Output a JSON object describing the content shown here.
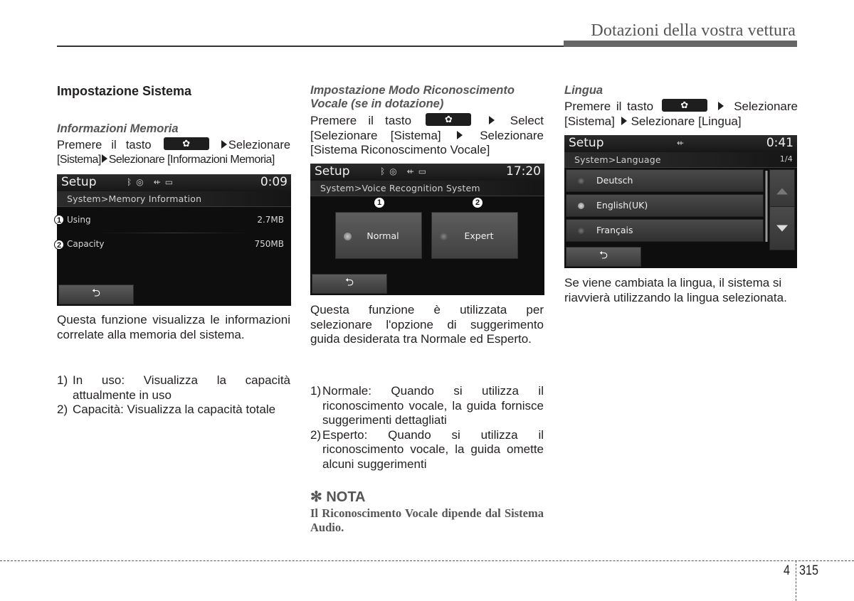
{
  "header": {
    "title": "Dotazioni della vostra vettura"
  },
  "col1": {
    "section_title": "Impostazione Sistema",
    "subtitle": "Informazioni Memoria",
    "instr_a": "Premere il tasto",
    "instr_b": "Selezionare",
    "instr_c": "[Sistema]",
    "instr_d": "Selezionare [Informazioni Memoria]",
    "screen": {
      "title": "Setup",
      "time": "0:09",
      "status_icons": [
        "bluetooth-icon",
        "disc-icon",
        "usb-icon",
        "aux-icon"
      ],
      "breadcrumb": "System>Memory Information",
      "rows": [
        {
          "callout": "1",
          "label": "Using",
          "value": "2.7MB"
        },
        {
          "callout": "2",
          "label": "Capacity",
          "value": "750MB"
        }
      ],
      "back_icon": "back-arrow-icon"
    },
    "description": "Questa funzione visualizza le informazioni correlate alla memoria del sistema.",
    "list": [
      {
        "n": "1)",
        "text": "In uso: Visualizza la capacità attualmente in uso"
      },
      {
        "n": "2)",
        "text": "Capacità: Visualizza la capacità totale"
      }
    ]
  },
  "col2": {
    "subtitle": "Impostazione Modo Riconoscimento Vocale (se in dotazione)",
    "instr_a": "Premere il tasto",
    "instr_b": "Select",
    "instr_c": "[Selezionare [Sistema]",
    "instr_d": "Selezionare",
    "instr_e": "[Sistema Riconoscimento Vocale]",
    "screen": {
      "title": "Setup",
      "time": "17:20",
      "breadcrumb": "System>Voice Recognition System",
      "options": [
        {
          "callout": "1",
          "label": "Normal",
          "selected": true
        },
        {
          "callout": "2",
          "label": "Expert",
          "selected": false
        }
      ]
    },
    "description": "Questa funzione è utilizzata per selezionare l'opzione di suggerimento guida desiderata tra Normale ed Esperto.",
    "list": [
      {
        "n": "1)",
        "text": "Normale: Quando si utilizza il riconoscimento vocale, la guida fornisce suggerimenti dettagliati"
      },
      {
        "n": "2)",
        "text": "Esperto: Quando si utilizza il riconoscimento vocale, la guida omette alcuni suggerimenti"
      }
    ],
    "nota_symbol": "✻",
    "nota_title": "NOTA",
    "nota_body": "Il Riconoscimento Vocale dipende dal Sistema Audio."
  },
  "col3": {
    "subtitle": "Lingua",
    "instr_a": "Premere il tasto",
    "instr_b": "Selezionare",
    "instr_c": "[Sistema]",
    "instr_d": "Selezionare [Lingua]",
    "screen": {
      "title": "Setup",
      "time": "0:41",
      "breadcrumb": "System>Language",
      "page_indicator": "1/4",
      "languages": [
        {
          "label": "Deutsch",
          "selected": false
        },
        {
          "label": "English(UK)",
          "selected": true
        },
        {
          "label": "Français",
          "selected": false
        }
      ]
    },
    "description": "Se viene cambiata la lingua, il sistema si riavvierà utilizzando la lingua selezionata."
  },
  "footer": {
    "chapter": "4",
    "page": "315"
  }
}
